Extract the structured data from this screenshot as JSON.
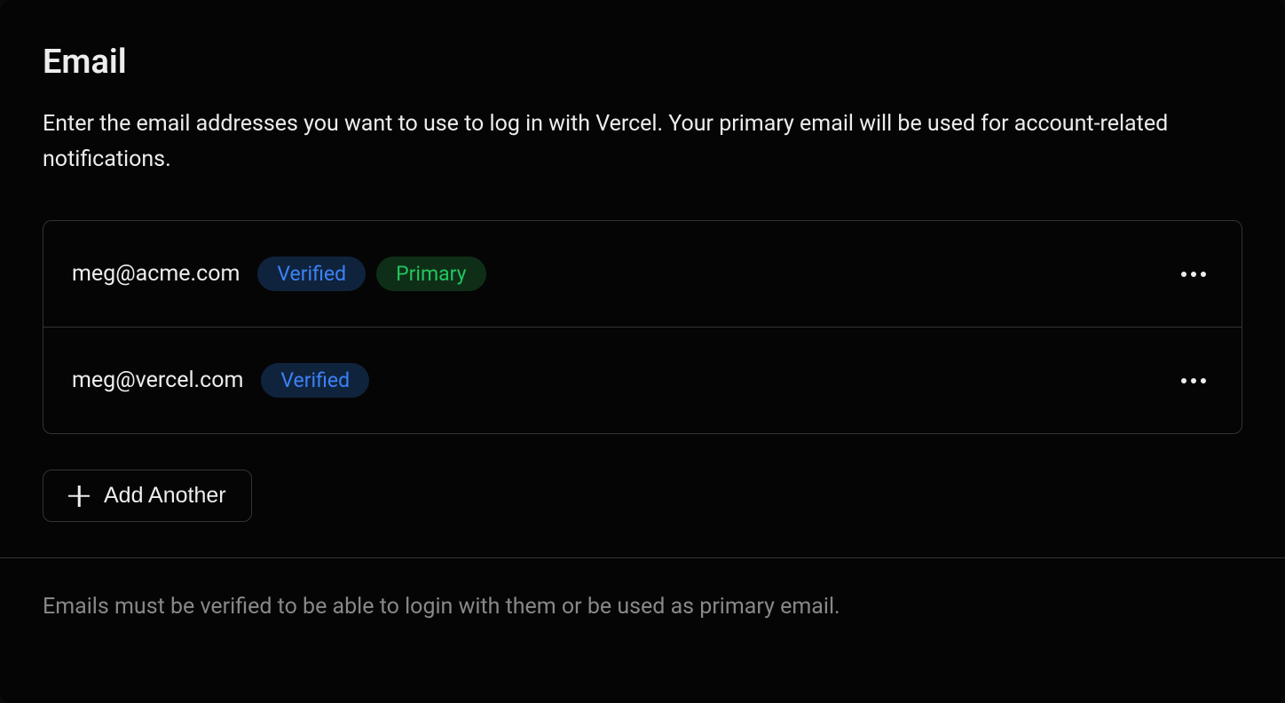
{
  "section": {
    "title": "Email",
    "description": "Enter the email addresses you want to use to log in with Vercel. Your primary email will be used for account-related notifications."
  },
  "emails": [
    {
      "address": "meg@acme.com",
      "verified_label": "Verified",
      "primary_label": "Primary",
      "is_primary": true
    },
    {
      "address": "meg@vercel.com",
      "verified_label": "Verified",
      "primary_label": "",
      "is_primary": false
    }
  ],
  "actions": {
    "add_another_label": "Add Another"
  },
  "footer": {
    "note": "Emails must be verified to be able to login with them or be used as primary email."
  }
}
